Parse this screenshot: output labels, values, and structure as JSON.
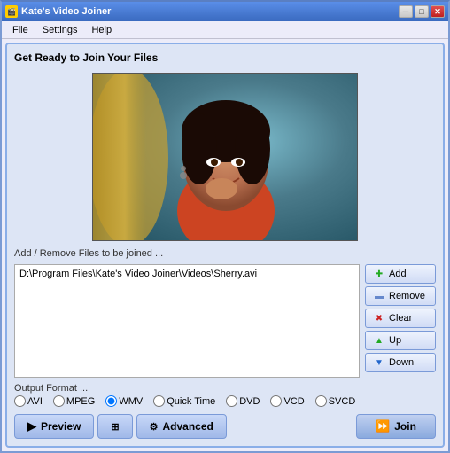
{
  "window": {
    "title": "Kate's Video Joiner",
    "title_icon": "🎬"
  },
  "titlebar": {
    "min_btn": "─",
    "max_btn": "□",
    "close_btn": "✕"
  },
  "menu": {
    "items": [
      "File",
      "Settings",
      "Help"
    ]
  },
  "main": {
    "section_title": "Get Ready to Join Your Files",
    "files_label": "Add / Remove Files to be joined ...",
    "files": [
      "D:\\Program Files\\Kate's Video Joiner\\Videos\\Sherry.avi"
    ],
    "buttons": {
      "add": "Add",
      "remove": "Remove",
      "clear": "Clear",
      "up": "Up",
      "down": "Down"
    },
    "output_label": "Output Format ...",
    "formats": [
      "AVI",
      "MPEG",
      "WMV",
      "Quick Time",
      "DVD",
      "VCD",
      "SVCD"
    ],
    "selected_format": "WMV",
    "bottom": {
      "preview_label": "Preview",
      "advanced_label": "Advanced",
      "join_label": "Join"
    }
  }
}
